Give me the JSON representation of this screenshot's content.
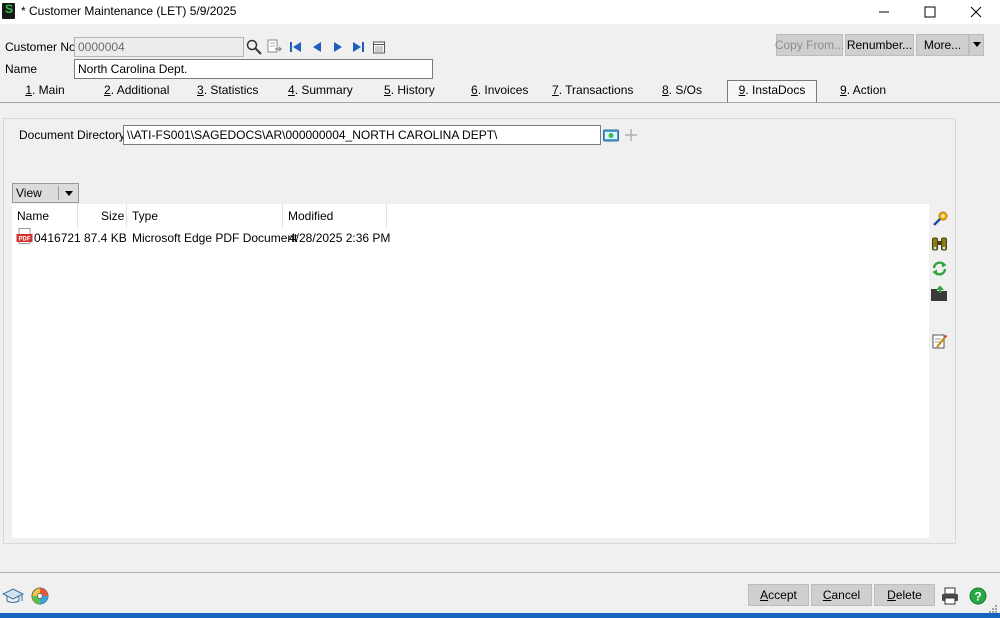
{
  "window": {
    "title": "* Customer Maintenance (LET) 5/9/2025",
    "app_icon_letter": "S",
    "minimize_icon": "minimize-icon",
    "maximize_icon": "maximize-icon",
    "close_icon": "close-icon"
  },
  "header": {
    "customer_no_label": "Customer No.",
    "customer_no_value": "0000004",
    "name_label": "Name",
    "name_value": "North Carolina Dept.",
    "copy_from_label": "Copy From...",
    "renumber_label": "Renumber...",
    "more_label": "More..."
  },
  "tabs": [
    {
      "num": "1",
      "label": ". Main"
    },
    {
      "num": "2",
      "label": ". Additional"
    },
    {
      "num": "3",
      "label": ". Statistics"
    },
    {
      "num": "4",
      "label": ". Summary"
    },
    {
      "num": "5",
      "label": ". History"
    },
    {
      "num": "6",
      "label": ". Invoices"
    },
    {
      "num": "7",
      "label": ". Transactions"
    },
    {
      "num": "8",
      "label": ". S/Os"
    },
    {
      "num": "9",
      "label": ". InstaDocs"
    },
    {
      "num": "9",
      "label": ". Action"
    }
  ],
  "instadocs": {
    "doc_dir_label": "Document Directory",
    "doc_dir_value": "\\\\ATI-FS001\\SAGEDOCS\\AR\\000000004_NORTH CAROLINA DEPT\\",
    "view_label": "View",
    "columns": [
      "Name",
      "Size",
      "Type",
      "Modified"
    ],
    "files": [
      {
        "name": "0416721",
        "size": "87.4 KB",
        "type": "Microsoft Edge PDF Document",
        "modified": "4/28/2025 2:36 PM",
        "icon": "pdf-icon"
      }
    ]
  },
  "footer": {
    "accept_u": "A",
    "accept_rest": "ccept",
    "cancel_u": "C",
    "cancel_rest": "ancel",
    "delete_u": "D",
    "delete_rest": "elete"
  },
  "colors": {
    "accent_green": "#35c24a",
    "pdf_red": "#d32f2f"
  }
}
